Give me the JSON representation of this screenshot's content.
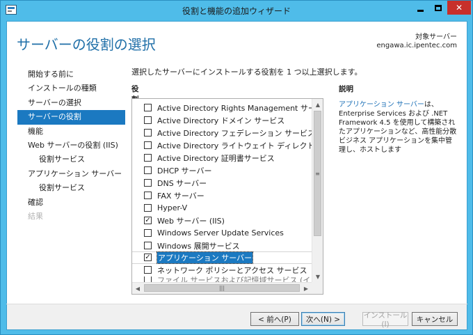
{
  "window": {
    "title": "役割と機能の追加ウィザード"
  },
  "header": {
    "page_title": "サーバーの役割の選択",
    "target_label": "対象サーバー",
    "target_server": "engawa.ic.ipentec.com"
  },
  "nav": {
    "items": [
      {
        "label": "開始する前に",
        "state": "normal"
      },
      {
        "label": "インストールの種類",
        "state": "normal"
      },
      {
        "label": "サーバーの選択",
        "state": "normal"
      },
      {
        "label": "サーバーの役割",
        "state": "selected"
      },
      {
        "label": "機能",
        "state": "normal"
      },
      {
        "label": "Web サーバーの役割 (IIS)",
        "state": "normal"
      },
      {
        "label": "役割サービス",
        "state": "sub"
      },
      {
        "label": "アプリケーション サーバー",
        "state": "normal"
      },
      {
        "label": "役割サービス",
        "state": "sub"
      },
      {
        "label": "確認",
        "state": "normal"
      },
      {
        "label": "結果",
        "state": "disabled"
      }
    ]
  },
  "main": {
    "instruction": "選択したサーバーにインストールする役割を 1 つ以上選択します。",
    "roles_heading": "役割",
    "roles": [
      {
        "label": "Active Directory Rights Management サービス",
        "checked": false
      },
      {
        "label": "Active Directory ドメイン サービス",
        "checked": false
      },
      {
        "label": "Active Directory フェデレーション サービス",
        "checked": false
      },
      {
        "label": "Active Directory ライトウェイト ディレクトリ サービス",
        "checked": false
      },
      {
        "label": "Active Directory 証明書サービス",
        "checked": false
      },
      {
        "label": "DHCP サーバー",
        "checked": false
      },
      {
        "label": "DNS サーバー",
        "checked": false
      },
      {
        "label": "FAX サーバー",
        "checked": false
      },
      {
        "label": "Hyper-V",
        "checked": false
      },
      {
        "label": "Web サーバー (IIS)",
        "checked": true
      },
      {
        "label": "Windows Server Update Services",
        "checked": false
      },
      {
        "label": "Windows 展開サービス",
        "checked": false
      },
      {
        "label": "アプリケーション サーバー",
        "checked": true,
        "focused": true
      },
      {
        "label": "ネットワーク ポリシーとアクセス サービス",
        "checked": false
      },
      {
        "label": "ファイル サービスおよび記憶域サービス (インストール済み)",
        "checked": false,
        "partial": true
      }
    ]
  },
  "description": {
    "heading": "説明",
    "link_text": "アプリケーション サーバー",
    "text": "は、Enterprise Services および .NET Framework 4.5 を使用して構築されたアプリケーションなど、高性能分散ビジネス アプリケーションを集中管理し、ホストします"
  },
  "footer": {
    "prev": "< 前へ(P)",
    "next": "次へ(N) >",
    "install": "インストール(I)",
    "cancel": "キャンセル"
  },
  "colors": {
    "accent": "#1b79c1",
    "window_frame": "#4fbce9",
    "title_blue": "#1f6fa8",
    "close_red": "#c7302b"
  }
}
